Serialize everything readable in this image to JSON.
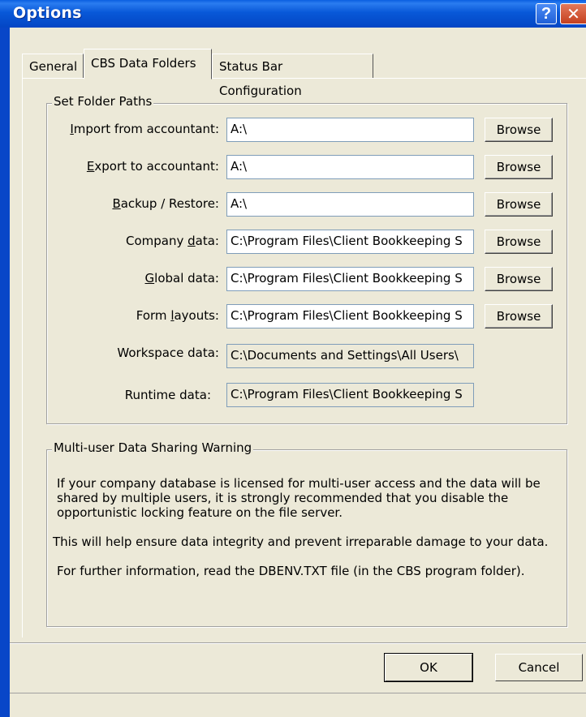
{
  "window": {
    "title": "Options",
    "help_glyph": "?",
    "close_glyph": "✕"
  },
  "tabs": [
    {
      "label": "General"
    },
    {
      "label": "CBS Data Folders",
      "selected": true
    },
    {
      "label": "Status Bar Configuration"
    }
  ],
  "folders_group": {
    "legend": "Set Folder Paths",
    "rows": [
      {
        "label_pre": "",
        "label_ul": "I",
        "label_post": "mport from accountant:",
        "value": "A:\\",
        "browse": "Browse",
        "editable": true
      },
      {
        "label_pre": "",
        "label_ul": "E",
        "label_post": "xport to accountant:",
        "value": "A:\\",
        "browse": "Browse",
        "editable": true
      },
      {
        "label_pre": "",
        "label_ul": "B",
        "label_post": "ackup / Restore:",
        "value": "A:\\",
        "browse": "Browse",
        "editable": true
      },
      {
        "label_pre": "Company ",
        "label_ul": "d",
        "label_post": "ata:",
        "value": "C:\\Program Files\\Client Bookkeeping S",
        "browse": "Browse",
        "editable": true
      },
      {
        "label_pre": "",
        "label_ul": "G",
        "label_post": "lobal data:",
        "value": "C:\\Program Files\\Client Bookkeeping S",
        "browse": "Browse",
        "editable": true
      },
      {
        "label_pre": "Form ",
        "label_ul": "l",
        "label_post": "ayouts:",
        "value": "C:\\Program Files\\Client Bookkeeping S",
        "browse": "Browse",
        "editable": true
      },
      {
        "label_pre": "Workspace data:",
        "label_ul": "",
        "label_post": "",
        "value": "C:\\Documents and Settings\\All Users\\",
        "editable": false
      },
      {
        "label_pre": "Runtime data:",
        "label_ul": "",
        "label_post": "",
        "value": "C:\\Program Files\\Client Bookkeeping S",
        "editable": false
      }
    ]
  },
  "warning_group": {
    "legend": "Multi-user Data Sharing Warning",
    "paragraph1": "If your company database is licensed for multi-user access and the data will be shared by multiple users, it is strongly recommended that you disable the opportunistic locking feature on the file server.",
    "paragraph2": "This will help ensure data integrity and prevent irreparable damage to your data.",
    "paragraph3": "For further information, read the DBENV.TXT file (in the CBS program folder)."
  },
  "buttons": {
    "ok": "OK",
    "cancel": "Cancel"
  }
}
